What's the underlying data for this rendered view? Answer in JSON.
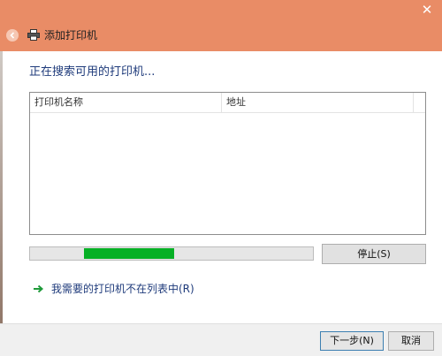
{
  "window": {
    "title": "添加打印机",
    "close_glyph": "✕",
    "accent_color": "#e98c66"
  },
  "main": {
    "instruction": "正在搜索可用的打印机...",
    "list": {
      "columns": [
        "打印机名称",
        "地址"
      ],
      "rows": []
    },
    "progress": {
      "start_fraction": 0.19,
      "end_fraction": 0.51,
      "color": "#06b025"
    },
    "stop_label": "停止(S)",
    "not_listed_link": "我需要的打印机不在列表中(R)"
  },
  "footer": {
    "next_label": "下一步(N)",
    "cancel_label": "取消"
  }
}
